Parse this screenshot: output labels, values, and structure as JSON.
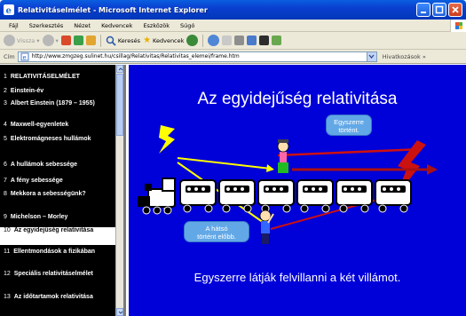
{
  "window": {
    "title": "Relativitáselmélet - Microsoft Internet Explorer"
  },
  "menu": [
    "Fájl",
    "Szerkesztés",
    "Nézet",
    "Kedvencek",
    "Eszközök",
    "Súgó"
  ],
  "toolbar": {
    "back_label": "Vissza",
    "search_label": "Keresés",
    "favorites_label": "Kedvencek"
  },
  "address": {
    "label": "Cím",
    "url": "http://www.zmgzeg.sulinet.hu/csillag/Relativitas/Relativitas_elemei/frame.htm",
    "links_label": "Hivatkozások"
  },
  "sidebar": {
    "items": [
      {
        "num": "1",
        "label": "RELATIVITÁSELMÉLET",
        "active": false
      },
      {
        "num": "2",
        "label": "Einstein-év",
        "active": false
      },
      {
        "num": "3",
        "label": "Albert Einstein (1879 – 1955)",
        "active": false
      },
      {
        "num": "4",
        "label": "Maxwell-egyenletek",
        "active": false
      },
      {
        "num": "5",
        "label": "Elektromágneses hullámok",
        "active": false
      },
      {
        "num": "6",
        "label": "A hullámok sebessége",
        "active": false
      },
      {
        "num": "7",
        "label": "A fény sebessége",
        "active": false
      },
      {
        "num": "8",
        "label": "Mekkora a sebességünk?",
        "active": false
      },
      {
        "num": "9",
        "label": "Michelson – Morley",
        "active": false
      },
      {
        "num": "10",
        "label": "Az egyidejűség relativitása",
        "active": true
      },
      {
        "num": "11",
        "label": "Ellentmondások a fizikában",
        "active": false
      },
      {
        "num": "12",
        "label": "Speciális relativitáselmélet",
        "active": false
      },
      {
        "num": "13",
        "label": "Az időtartamok relativitása",
        "active": false
      }
    ]
  },
  "slide": {
    "title": "Az egyidejűség relativitása",
    "bubble_top": [
      "Egyszerre",
      "történt."
    ],
    "bubble_bottom": [
      "A hátsó",
      "történt előbb."
    ],
    "caption": "Egyszerre látják felvillanni a két villámot."
  },
  "colors": {
    "stage_bg": "#0000d8",
    "sidebar_bg": "#000000",
    "title_bar": "#0a3fd0",
    "bubble": "#63a8e6",
    "lightning": "#ffff00",
    "ray": "#cc1111"
  }
}
